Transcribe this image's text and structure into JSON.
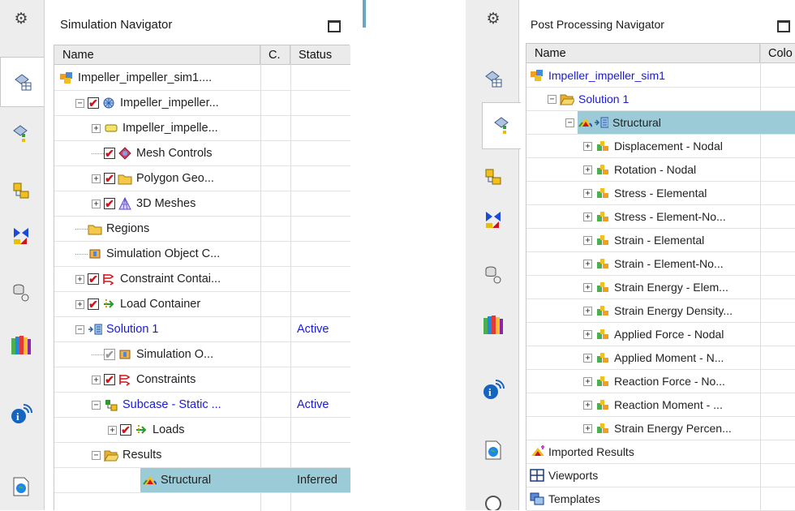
{
  "left_panel": {
    "title": "Simulation Navigator",
    "columns": [
      "Name",
      "C.",
      "Status"
    ],
    "rows": [
      {
        "label": "Impeller_impeller_sim1....",
        "status": "",
        "icon": "sim-file-icon",
        "blue": false
      },
      {
        "label": "Impeller_impeller...",
        "status": "",
        "icon": "fem-icon",
        "blue": false
      },
      {
        "label": "Impeller_impelle...",
        "status": "",
        "icon": "part-icon",
        "blue": false
      },
      {
        "label": "Mesh Controls",
        "status": "",
        "icon": "mesh-controls-icon",
        "blue": false
      },
      {
        "label": "Polygon Geo...",
        "status": "",
        "icon": "folder-icon",
        "blue": false
      },
      {
        "label": "3D Meshes",
        "status": "",
        "icon": "mesh-3d-icon",
        "blue": false
      },
      {
        "label": "Regions",
        "status": "",
        "icon": "folder-icon",
        "blue": false
      },
      {
        "label": "Simulation Object C...",
        "status": "",
        "icon": "sim-object-icon",
        "blue": false
      },
      {
        "label": "Constraint Contai...",
        "status": "",
        "icon": "constraint-icon",
        "blue": false
      },
      {
        "label": "Load Container",
        "status": "",
        "icon": "load-icon",
        "blue": false
      },
      {
        "label": "Solution 1",
        "status": "Active",
        "icon": "solution-icon",
        "blue": true
      },
      {
        "label": "Simulation O...",
        "status": "",
        "icon": "sim-object-icon",
        "blue": false
      },
      {
        "label": "Constraints",
        "status": "",
        "icon": "constraint-icon",
        "blue": false
      },
      {
        "label": "Subcase - Static ...",
        "status": "Active",
        "icon": "subcase-icon",
        "blue": true
      },
      {
        "label": "Loads",
        "status": "",
        "icon": "load-icon",
        "blue": false
      },
      {
        "label": "Results",
        "status": "",
        "icon": "folder-open-icon",
        "blue": false
      },
      {
        "label": "Structural",
        "status": "Inferred",
        "icon": "results-icon",
        "blue": false
      }
    ]
  },
  "right_panel": {
    "title": "Post Processing Navigator",
    "columns": [
      "Name",
      "Colo"
    ],
    "rows": [
      {
        "label": "Impeller_impeller_sim1",
        "icon": "sim-file-icon",
        "blue": true
      },
      {
        "label": "Solution 1",
        "icon": "folder-open-icon",
        "blue": true
      },
      {
        "label": "Structural",
        "icon": "results-icon",
        "blue": false
      },
      {
        "label": "Displacement - Nodal",
        "icon": "result-type-icon",
        "blue": false
      },
      {
        "label": "Rotation - Nodal",
        "icon": "result-type-icon",
        "blue": false
      },
      {
        "label": "Stress - Elemental",
        "icon": "result-type-icon",
        "blue": false
      },
      {
        "label": "Stress - Element-No...",
        "icon": "result-type-icon",
        "blue": false
      },
      {
        "label": "Strain - Elemental",
        "icon": "result-type-icon",
        "blue": false
      },
      {
        "label": "Strain - Element-No...",
        "icon": "result-type-icon",
        "blue": false
      },
      {
        "label": "Strain Energy - Elem...",
        "icon": "result-type-icon",
        "blue": false
      },
      {
        "label": "Strain Energy Density...",
        "icon": "result-type-icon",
        "blue": false
      },
      {
        "label": "Applied Force - Nodal",
        "icon": "result-type-icon",
        "blue": false
      },
      {
        "label": "Applied Moment - N...",
        "icon": "result-type-icon",
        "blue": false
      },
      {
        "label": "Reaction Force - No...",
        "icon": "result-type-icon",
        "blue": false
      },
      {
        "label": "Reaction Moment - ...",
        "icon": "result-type-icon",
        "blue": false
      },
      {
        "label": "Strain Energy Percen...",
        "icon": "result-type-icon",
        "blue": false
      },
      {
        "label": "Imported Results",
        "icon": "imported-results-icon",
        "blue": false
      },
      {
        "label": "Viewports",
        "icon": "viewports-icon",
        "blue": false
      },
      {
        "label": "Templates",
        "icon": "templates-icon",
        "blue": false
      }
    ]
  },
  "colors": {
    "selection": "#9ccbd8",
    "link_blue": "#1a1ad6",
    "check_red": "#d0141c"
  }
}
